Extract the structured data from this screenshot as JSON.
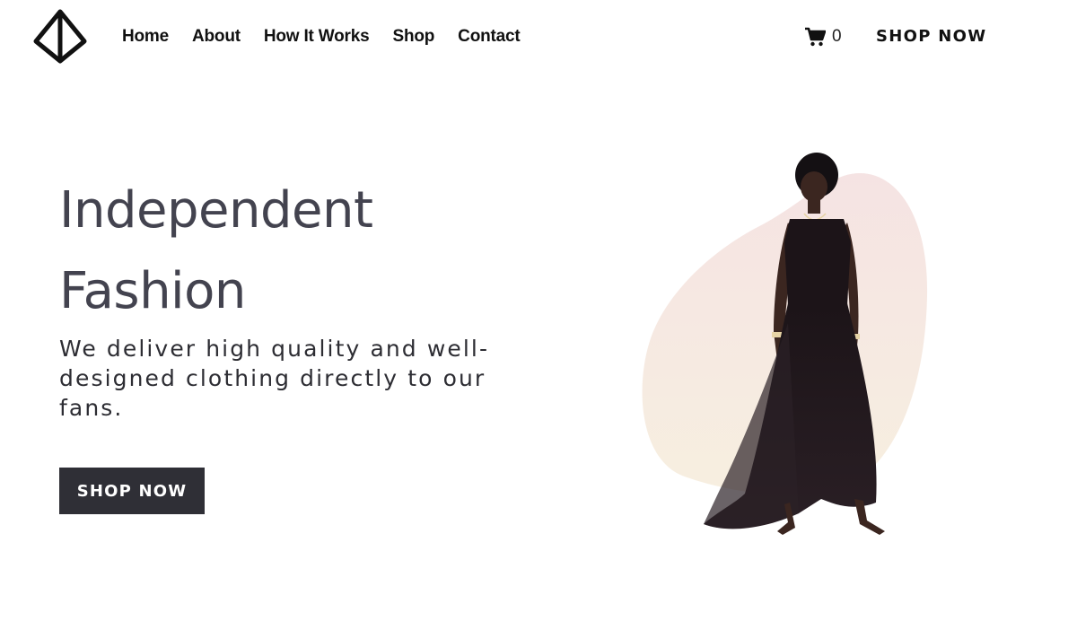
{
  "header": {
    "logo_icon": "diamond-triangle-logo-icon",
    "nav": [
      {
        "label": "Home"
      },
      {
        "label": "About"
      },
      {
        "label": "How It Works"
      },
      {
        "label": "Shop"
      },
      {
        "label": "Contact"
      }
    ],
    "cart": {
      "icon": "shopping-cart-icon",
      "count": "0"
    },
    "cta_label": "SHOP NOW"
  },
  "hero": {
    "title_line1": "Independent",
    "title_line2": "Fashion",
    "subtitle": "We deliver high quality and well-designed clothing directly to our fans.",
    "button_label": "SHOP NOW",
    "image_alt": "model-in-black-gown"
  },
  "colors": {
    "text_dark": "#111111",
    "title": "#43434f",
    "button_bg": "#2f2f36",
    "blob_top": "#f4e4e4",
    "blob_bottom": "#f6ecdc",
    "dress": "#1c1418"
  }
}
